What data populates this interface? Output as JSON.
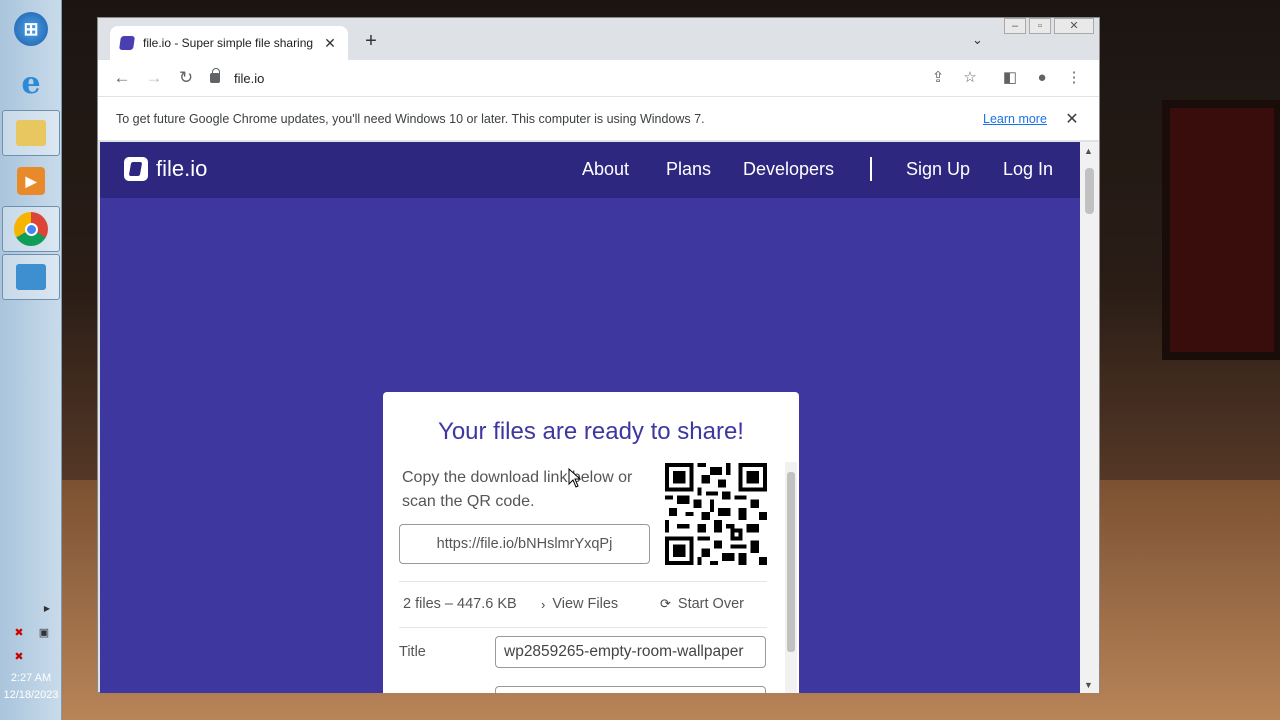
{
  "taskbar": {
    "items": [
      {
        "name": "start-button-icon"
      },
      {
        "name": "internet-explorer-icon"
      },
      {
        "name": "file-explorer-icon"
      },
      {
        "name": "media-player-icon"
      },
      {
        "name": "chrome-icon"
      },
      {
        "name": "remote-desktop-icon"
      }
    ],
    "clock": {
      "time": "2:27 AM",
      "date": "12/18/2023"
    }
  },
  "browser": {
    "tab": {
      "title": "file.io - Super simple file sharing"
    },
    "url": "file.io",
    "infobar": {
      "message": "To get future Google Chrome updates, you'll need Windows 10 or later. This computer is using Windows 7.",
      "link": "Learn more"
    }
  },
  "site": {
    "logo": "file.io",
    "nav": [
      "About",
      "Plans",
      "Developers",
      "Sign Up",
      "Log In"
    ],
    "colors": {
      "header": "#2e2780",
      "background": "#3e37a0",
      "accent": "#3e37a0"
    }
  },
  "card": {
    "title": "Your files are ready to share!",
    "description": "Copy the download link below or scan the QR code.",
    "link": "https://file.io/bNHslmrYxqPj",
    "files_info": "2 files – 447.6 KB",
    "view_files": "View Files",
    "start_over": "Start Over",
    "title_label": "Title",
    "title_value": "wp2859265-empty-room-wallpaper"
  }
}
